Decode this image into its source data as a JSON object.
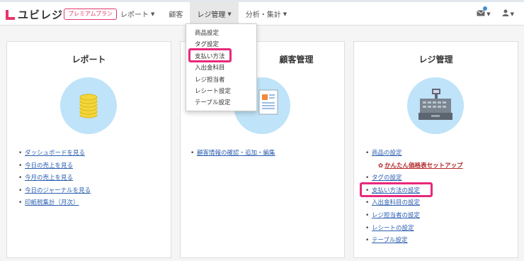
{
  "header": {
    "logo_text": "ユビレジ",
    "plan_badge": "プレミアムプラン",
    "nav": [
      {
        "label": "レポート",
        "has_caret": true
      },
      {
        "label": "顧客",
        "has_caret": false
      },
      {
        "label": "レジ管理",
        "has_caret": true,
        "active": true
      },
      {
        "label": "分析・集計",
        "has_caret": true
      }
    ],
    "right_icons": [
      "mail-icon",
      "user-icon"
    ]
  },
  "dropdown": {
    "items": [
      "商品設定",
      "タグ設定",
      "支払い方法",
      "入出金科目",
      "レジ担当者",
      "レシート設定",
      "テーブル設定"
    ],
    "highlighted_index": 2
  },
  "panels": {
    "report": {
      "title": "レポート",
      "icon": "coins-icon",
      "links": [
        "ダッシュボードを見る",
        "今日の売上を見る",
        "今月の売上を見る",
        "今日のジャーナルを見る",
        "印紙税集計（月次）"
      ]
    },
    "customer": {
      "title": "顧客管理",
      "icon": "document-icon",
      "links": [
        "顧客情報の確認・追加・編集"
      ]
    },
    "register": {
      "title": "レジ管理",
      "icon": "register-icon",
      "links": [
        "商品の設定",
        "かんたん価格表セットアップ",
        "タグの設定",
        "支払い方法の設定",
        "入出金科目の設定",
        "レジ担当者の設定",
        "レシートの設定",
        "テーブル設定"
      ],
      "highlighted_link": "支払い方法の設定"
    }
  },
  "colors": {
    "accent": "#e6356b",
    "highlight": "#e8297a",
    "link": "#2a5db0",
    "circle": "#bfe3f8"
  }
}
